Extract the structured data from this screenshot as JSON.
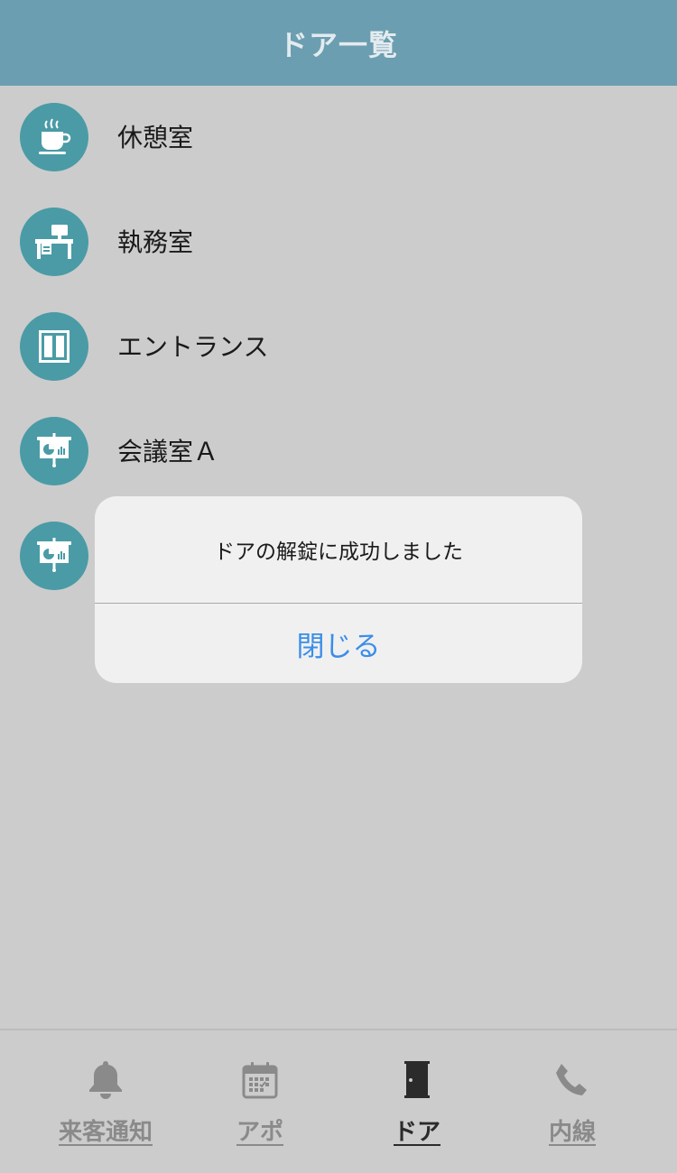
{
  "header": {
    "title": "ドア一覧"
  },
  "doors": [
    {
      "label": "休憩室",
      "icon": "coffee-cup-icon"
    },
    {
      "label": "執務室",
      "icon": "office-desk-icon"
    },
    {
      "label": "エントランス",
      "icon": "entrance-door-icon"
    },
    {
      "label": "会議室Ａ",
      "icon": "meeting-room-icon"
    },
    {
      "label": "",
      "icon": "meeting-room-icon"
    }
  ],
  "alert": {
    "message": "ドアの解錠に成功しました",
    "button_label": "閉じる"
  },
  "tabbar": {
    "tabs": [
      {
        "label": "来客通知",
        "icon": "bell-icon",
        "active": false
      },
      {
        "label": "アポ",
        "icon": "calendar-icon",
        "active": false
      },
      {
        "label": "ドア",
        "icon": "door-icon",
        "active": true
      },
      {
        "label": "内線",
        "icon": "phone-icon",
        "active": false
      }
    ]
  },
  "colors": {
    "header_bg": "#6b9eb0",
    "icon_circle": "#4a9ba6",
    "alert_button": "#3a8ee8",
    "background": "#cccccc"
  }
}
